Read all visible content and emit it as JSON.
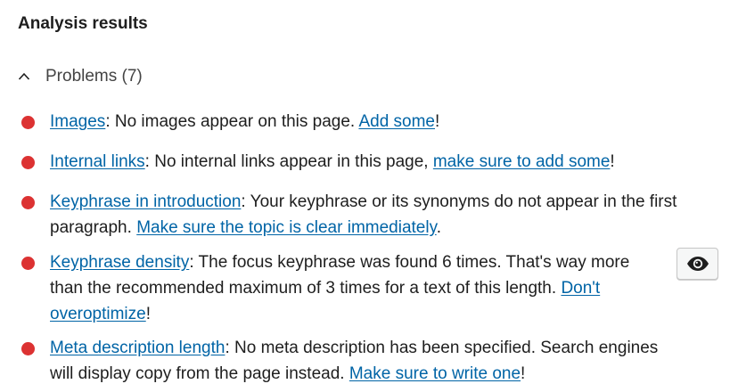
{
  "heading": "Analysis results",
  "problems_toggle": {
    "label": "Problems (7)",
    "icon": "chevron-up-icon"
  },
  "colors": {
    "bullet": "#dc3232",
    "link": "#0064a6"
  },
  "results": [
    {
      "link1": "Images",
      "text1": ": No images appear on this page. ",
      "link2": "Add some",
      "text2": "!"
    },
    {
      "link1": "Internal links",
      "text1": ": No internal links appear in this page, ",
      "link2": "make sure to add some",
      "text2": "!"
    },
    {
      "link1": "Keyphrase in introduction",
      "text1": ": Your keyphrase or its synonyms do not appear in the first paragraph. ",
      "link2": "Make sure the topic is clear immediately",
      "text2": "."
    },
    {
      "link1": "Keyphrase density",
      "text1": ": The focus keyphrase was found 6 times. That's way more than the recommended maximum of 3 times for a text of this length. ",
      "link2": "Don't overoptimize",
      "text2": "!",
      "action_icon": "eye-icon"
    },
    {
      "link1": "Meta description length",
      "text1": ": No meta description has been specified. Search engines will display copy from the page instead. ",
      "link2": "Make sure to write one",
      "text2": "!"
    }
  ]
}
